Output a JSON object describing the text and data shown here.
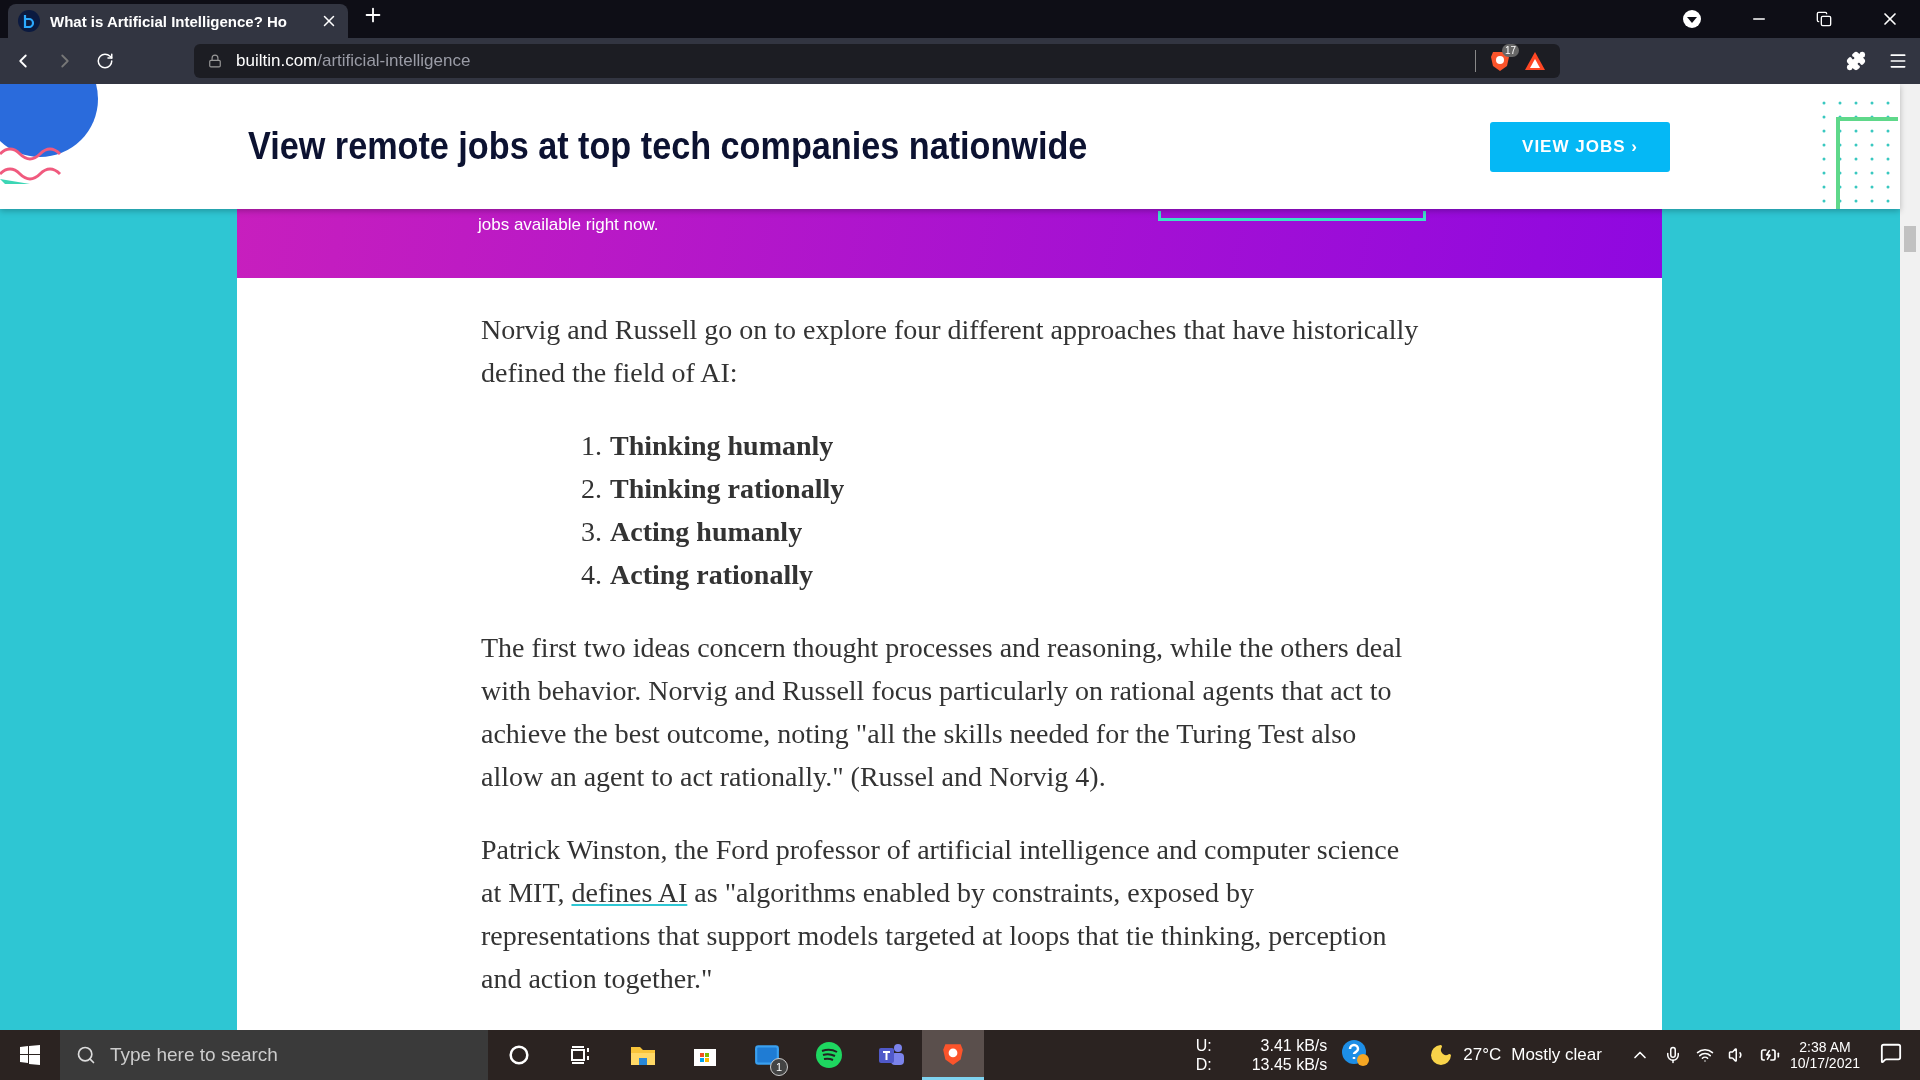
{
  "browser": {
    "tab": {
      "title": "What is Artificial Intelligence? Ho",
      "selected": true
    },
    "url_host": "builtin.com",
    "url_path": "/artificial-intelligence",
    "shields_count": "17"
  },
  "banner": {
    "headline": "View remote jobs at top tech companies nationwide",
    "button": "VIEW JOBS ›"
  },
  "promo": {
    "text": "jobs available right now."
  },
  "article": {
    "intro": "Norvig and Russell go on to explore four different approaches that have historically defined the field of AI:",
    "list": [
      {
        "number": "1.",
        "text": "Thinking humanly"
      },
      {
        "number": "2.",
        "text": "Thinking rationally"
      },
      {
        "number": "3.",
        "text": "Acting humanly"
      },
      {
        "number": "4.",
        "text": "Acting rationally"
      }
    ],
    "paragraph_1": "The first two ideas concern thought processes and reasoning, while the others deal with behavior. Norvig and Russell focus particularly on rational agents that act to achieve the best outcome, noting \"all the skills needed for the Turing Test also allow an agent to act rationally.\" (Russel and Norvig 4).",
    "paragraph_2": {
      "before": "Patrick Winston, the Ford professor of artificial intelligence and computer science at MIT,",
      "link": "defines AI",
      "after": "as  \"algorithms enabled by constraints, exposed by representations that support models targeted at loops that tie thinking, perception and action together.\""
    }
  },
  "taskbar": {
    "search_placeholder": "Type here to search",
    "mail_badge": "1",
    "upload_label": "U:",
    "upload_rate": "3.41 kB/s",
    "download_label": "D:",
    "download_rate": "13.45 kB/s",
    "temperature": "27°C",
    "weather": "Mostly clear",
    "time": "2:38 AM",
    "date": "10/17/2021"
  }
}
